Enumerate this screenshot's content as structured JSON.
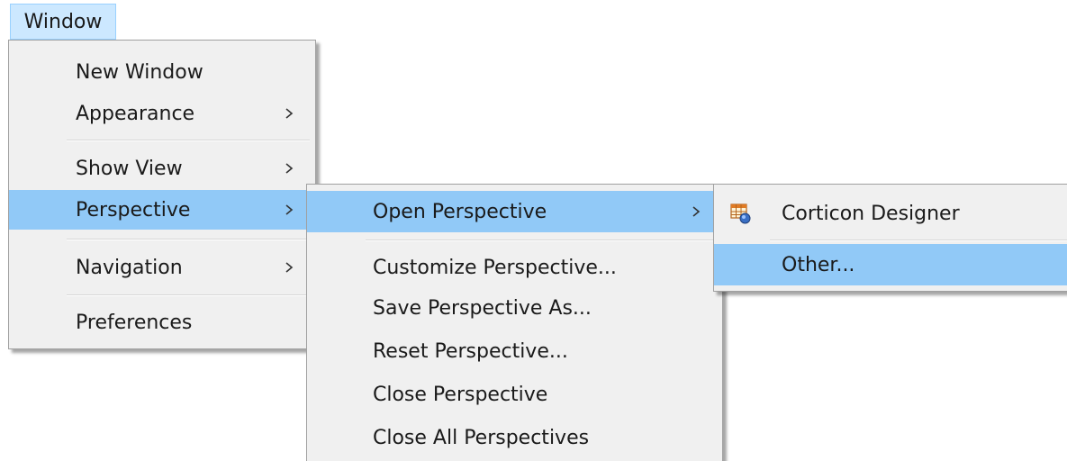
{
  "menubar": {
    "window_label": "Window"
  },
  "window_menu": {
    "items": [
      {
        "label": "New Window"
      },
      {
        "label": "Appearance"
      },
      {
        "label": "Show View"
      },
      {
        "label": "Perspective"
      },
      {
        "label": "Navigation"
      },
      {
        "label": "Preferences"
      }
    ]
  },
  "perspective_menu": {
    "items": [
      {
        "label": "Open Perspective"
      },
      {
        "label": "Customize Perspective..."
      },
      {
        "label": "Save Perspective As..."
      },
      {
        "label": "Reset Perspective..."
      },
      {
        "label": "Close Perspective"
      },
      {
        "label": "Close All Perspectives"
      }
    ]
  },
  "open_perspective_menu": {
    "items": [
      {
        "label": "Corticon Designer",
        "icon": "corticon-designer-icon"
      },
      {
        "label": "Other..."
      }
    ]
  },
  "colors": {
    "highlight": "#91c9f7",
    "menu_background": "#f0f0f0",
    "menubar_active": "#cce8ff"
  }
}
